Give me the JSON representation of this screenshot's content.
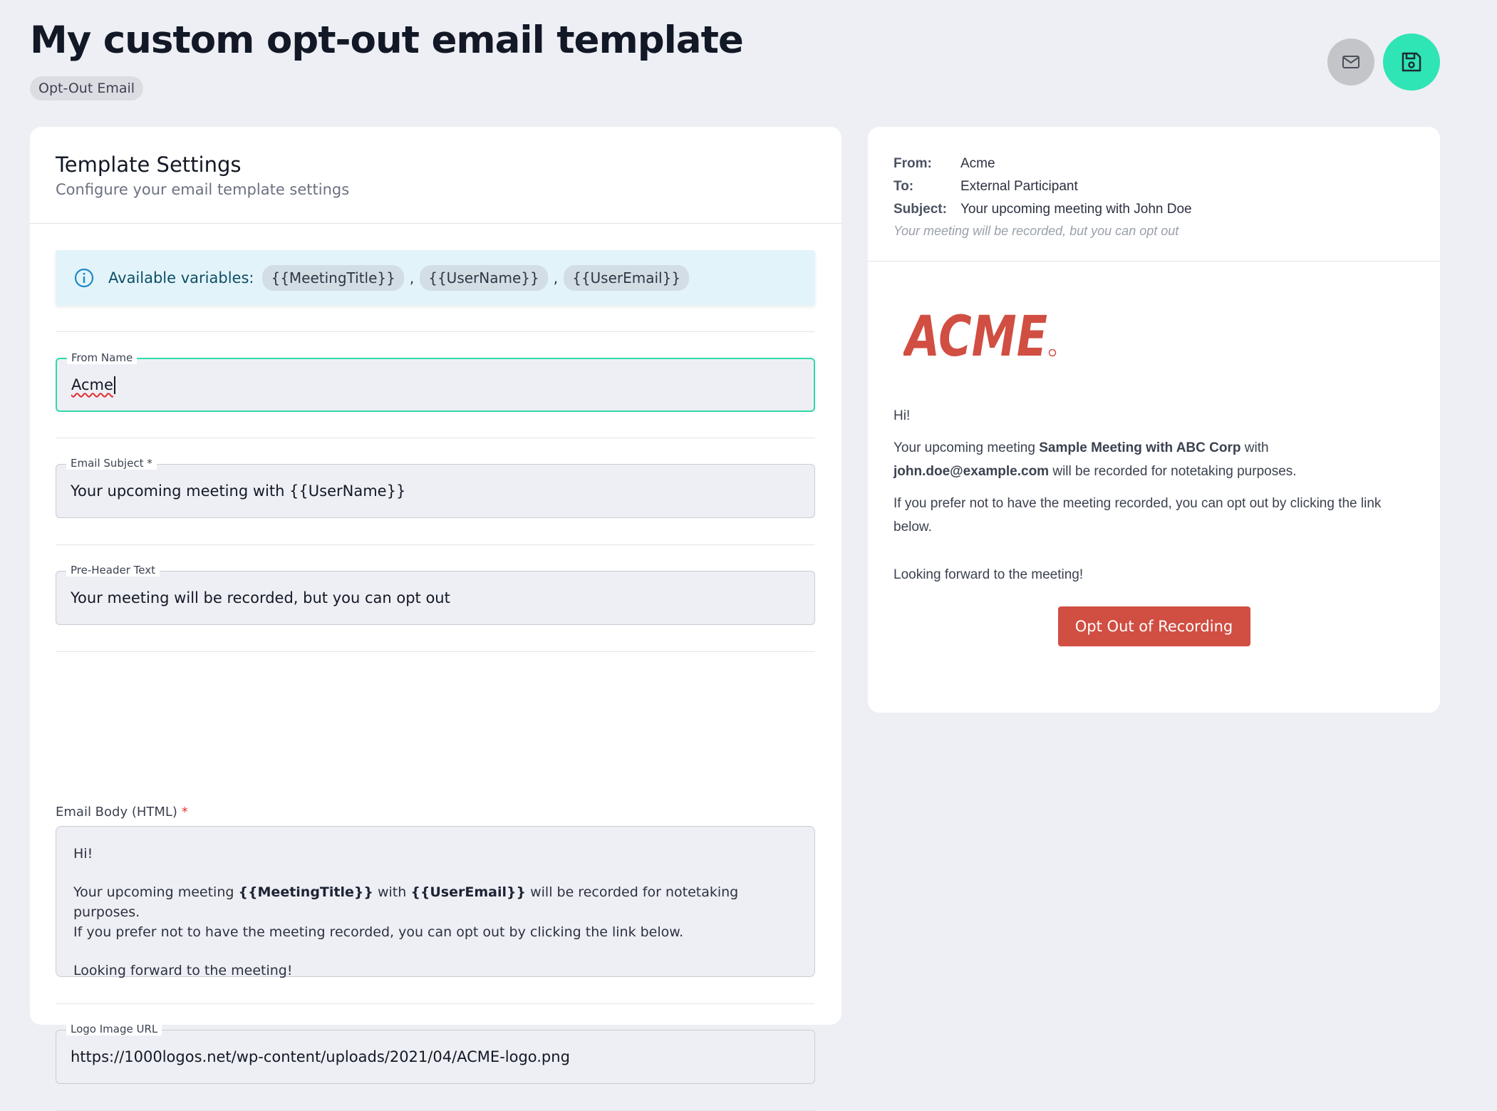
{
  "header": {
    "title": "My custom opt-out email template",
    "badge": "Opt-Out Email"
  },
  "actions": {
    "mail_icon": "mail-icon",
    "save_icon": "save-icon"
  },
  "settings": {
    "title": "Template Settings",
    "subtitle": "Configure your email template settings",
    "variables": {
      "label": "Available variables:",
      "items": [
        "{{MeetingTitle}}",
        "{{UserName}}",
        "{{UserEmail}}"
      ],
      "separator": ","
    },
    "from_name": {
      "label": "From Name",
      "value": "Acme"
    },
    "email_subject": {
      "label": "Email Subject *",
      "value": "Your upcoming meeting with {{UserName}}"
    },
    "pre_header": {
      "label": "Pre-Header Text",
      "value": "Your meeting will be recorded, but you can opt out"
    },
    "email_body": {
      "label": "Email Body (HTML)",
      "required": "*",
      "greeting": "Hi!",
      "line1_a": "Your upcoming meeting ",
      "line1_var1": "{{MeetingTitle}}",
      "line1_b": " with ",
      "line1_var2": "{{UserEmail}}",
      "line1_c": " will be recorded for notetaking purposes.",
      "line2": "If you prefer not to have the meeting recorded, you can opt out by clicking the link below.",
      "closing": "Looking forward to the meeting!"
    },
    "logo_url": {
      "label": "Logo Image URL",
      "value": "https://1000logos.net/wp-content/uploads/2021/04/ACME-logo.png"
    }
  },
  "preview": {
    "from_label": "From:",
    "from_value": "Acme",
    "to_label": "To:",
    "to_value": "External Participant",
    "subject_label": "Subject:",
    "subject_value": "Your upcoming meeting with John Doe",
    "preheader": "Your meeting will be recorded, but you can opt out",
    "logo_text": "ACME",
    "logo_color": "#d14e42",
    "greeting": "Hi!",
    "p1_a": "Your upcoming meeting ",
    "p1_meeting": "Sample Meeting with ABC Corp",
    "p1_b": " with ",
    "p1_email": "john.doe@example.com",
    "p1_c": " will be recorded for notetaking purposes.",
    "p2": "If you prefer not to have the meeting recorded, you can opt out by clicking the link below.",
    "closing": "Looking forward to the meeting!",
    "button": "Opt Out of Recording"
  },
  "colors": {
    "accent": "#2fe4b5",
    "danger": "#d14e42"
  }
}
